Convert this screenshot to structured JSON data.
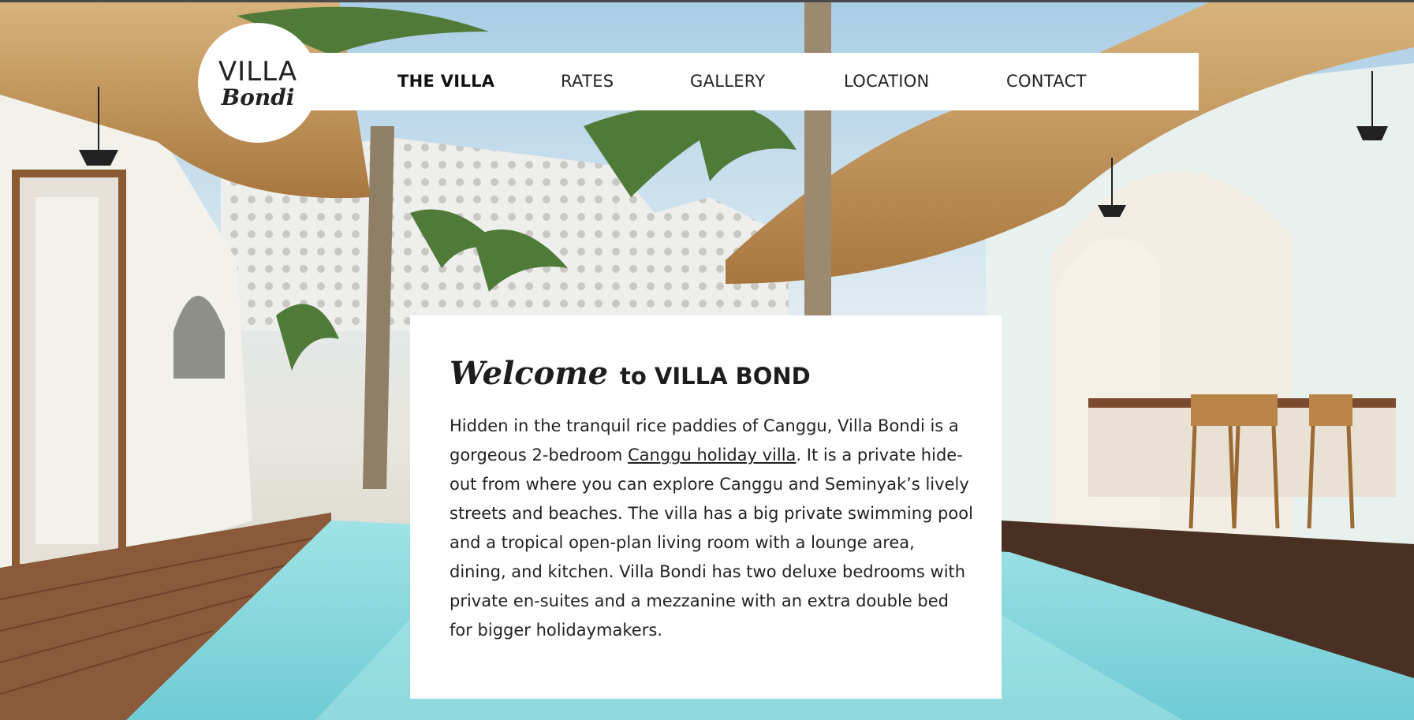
{
  "logo": {
    "line1": "VILLA",
    "line2": "Bondi"
  },
  "nav": {
    "items": [
      {
        "label": "THE VILLA",
        "active": true
      },
      {
        "label": "RATES"
      },
      {
        "label": "GALLERY"
      },
      {
        "label": "LOCATION"
      },
      {
        "label": "CONTACT"
      }
    ]
  },
  "welcome": {
    "title_script": "Welcome",
    "title_rest": "to VILLA BOND",
    "text_before_link": "Hidden in the tranquil rice paddies of Canggu, Villa Bondi is a gorgeous 2-bedroom ",
    "link": "Canggu holiday villa",
    "text_after_link": ". It is a private hide-out from where you can explore Canggu and Seminyak’s lively streets and beaches. The villa has a big private swimming pool and a tropical open-plan living room with a lounge area, dining, and kitchen. Villa Bondi has two deluxe bedrooms with private en-suites and a mezzanine with an extra double bed for bigger holidaymakers."
  },
  "colors": {
    "pool": "#8fdbe0",
    "wall": "#f1f0ea",
    "thatch": "#c9a06a",
    "wood": "#8a5a3a"
  }
}
